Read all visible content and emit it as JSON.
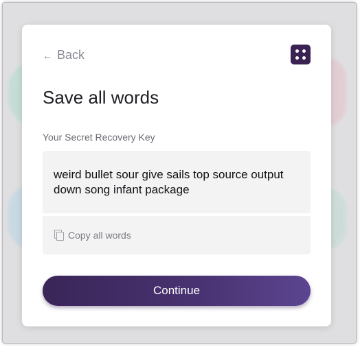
{
  "header": {
    "back_label": "Back",
    "back_icon": "arrow-left-icon",
    "dice_icon": "dice-icon"
  },
  "page": {
    "title": "Save all words",
    "key_label": "Your Secret Recovery Key",
    "recovery_key": "weird bullet sour give sails top source output down song infant package",
    "copy_label": "Copy all words",
    "copy_icon": "copy-icon",
    "continue_label": "Continue"
  },
  "colors": {
    "accent": "#3a2352",
    "button_gradient_start": "#3a2558",
    "button_gradient_end": "#5c4591",
    "field_bg": "#f3f3f4"
  }
}
